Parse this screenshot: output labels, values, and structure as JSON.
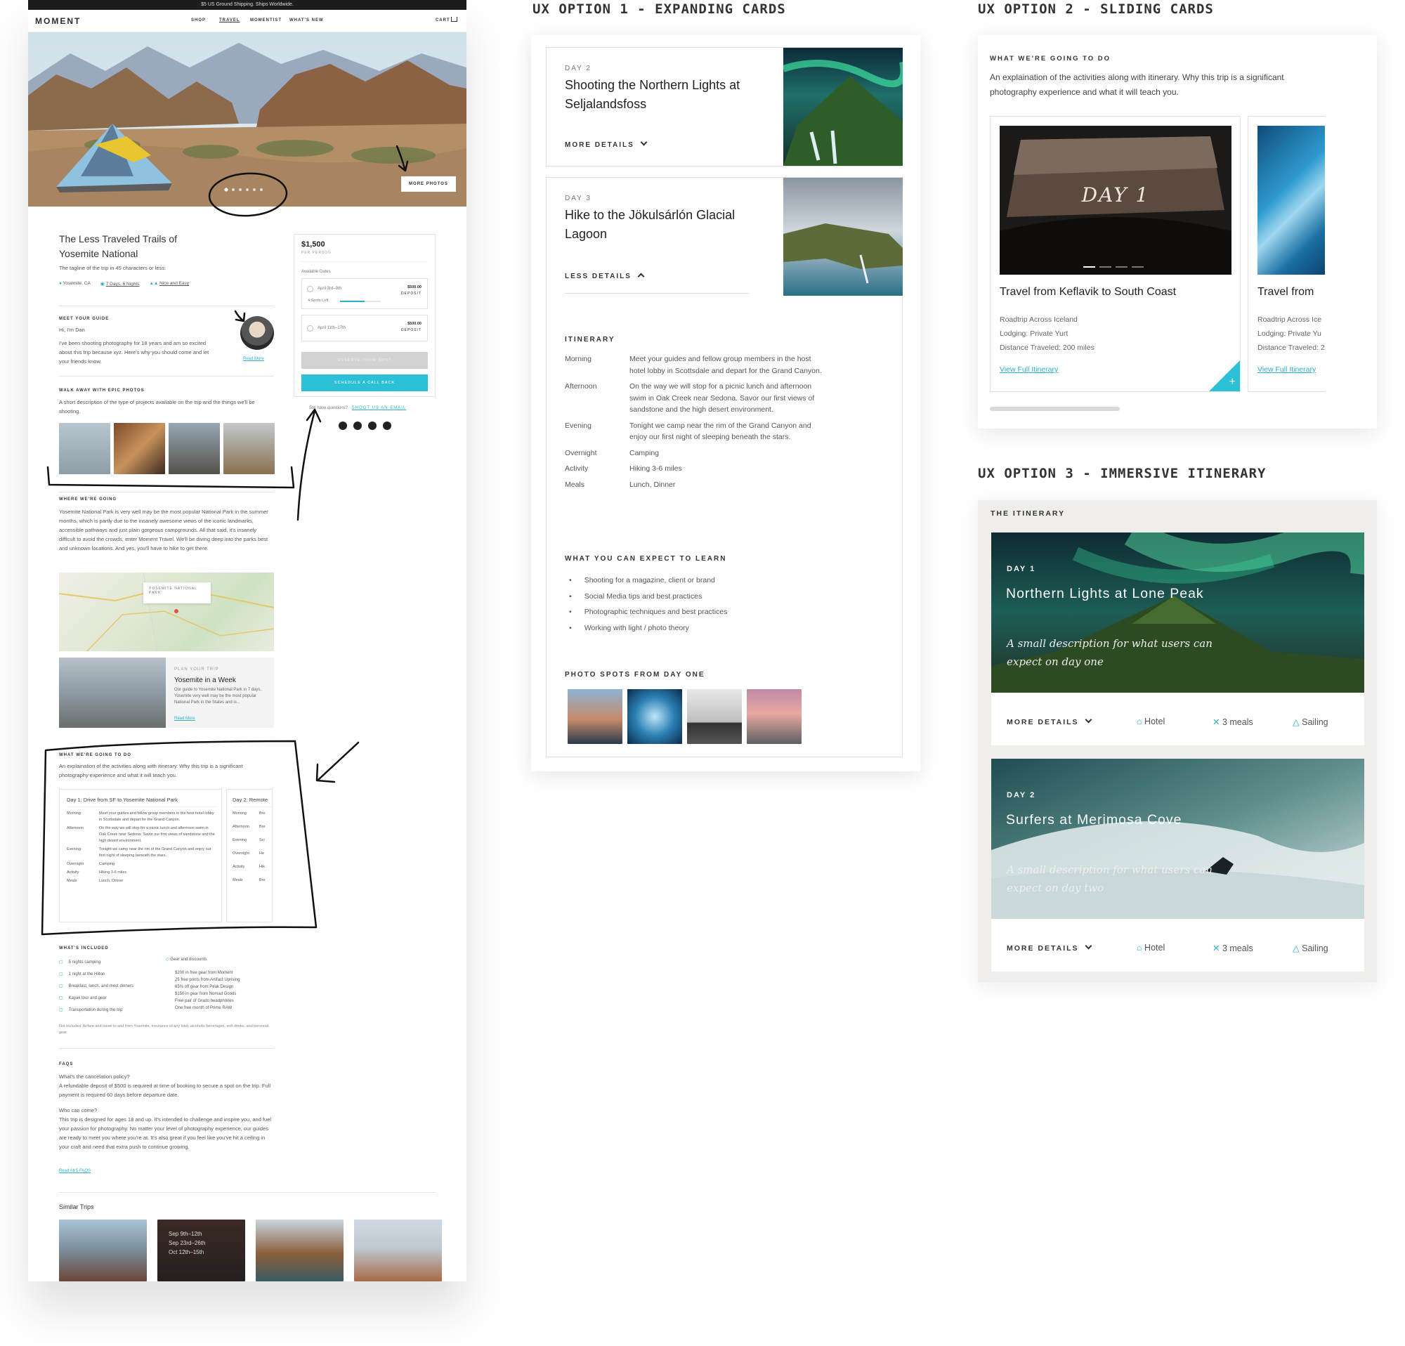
{
  "left_page": {
    "promo": "$5 US Ground Shipping. Ships Worldwide.",
    "logo": "MOMENT",
    "nav": [
      "SHOP",
      "TRAVEL",
      "MOMENTIST",
      "WHAT'S NEW"
    ],
    "cart": "CART",
    "more_photos": "MORE PHOTOS",
    "trip_title": "The Less Traveled Trails of Yosemite National",
    "tagline": "The tagline of the trip in 45 characters or less.",
    "meta": [
      "Yosemite, CA",
      "7 Days, 6 Nights",
      "Nice and Easy"
    ],
    "guide": {
      "label": "MEET YOUR GUIDE",
      "greeting": "Hi, I'm Dan",
      "text": "I've been shooting photography for 18 years and am so excited about this trip because xyz. Here's why you should come and let your friends know.",
      "read_more": "Read More"
    },
    "photos_section": {
      "label": "WALK AWAY WITH EPIC PHOTOS",
      "text": "A short description of the type of projects available on the trip and the things we'll be shooting."
    },
    "where": {
      "label": "WHERE WE'RE GOING",
      "text": "Yosemite National Park is very well may be the most popular National Park in the summer months, which is partly due to the insanely awesome views of the iconic landmarks, accessible pathways and just plain gorgeous campgrounds. All that said, it's insanely difficult to avoid the crowds, enter Moment Travel. We'll be diving deep into the parks best and unknown locations. And yes, you'll have to hike to get there.",
      "map_label": "YOSEMITE NATIONAL PARK"
    },
    "plan": {
      "label": "PLAN YOUR TRIP",
      "title": "Yosemite in a Week",
      "text": "Our guide to Yosemite National Park in 7 days. Yosemite very well may be the most popular National Park in the States and is...",
      "read_more": "Read More"
    },
    "booking": {
      "price": "$1,500",
      "per": "PER PERSON",
      "available": "Available Dates",
      "dates": [
        {
          "label": "April 3rd–9th",
          "price": "$500.00",
          "deposit": "DEPOSIT",
          "spots": "4 Spots Left"
        },
        {
          "label": "April 11th–17th",
          "price": "$500.00",
          "deposit": "DEPOSIT",
          "spots": ""
        }
      ],
      "reserve": "RESERVE YOUR SPOT",
      "schedule": "SCHEDULE A CALL BACK",
      "questions": "Still have questions?",
      "email": "SHOOT US AN EMAIL"
    },
    "todo": {
      "label": "WHAT WE'RE GOING TO DO",
      "text": "An explaination of the activities along with itinerary. Why this trip is a significant photography experience and what it will teach you.",
      "day1_title": "Day 1: Drive from SF to Yosemite National Park",
      "day2_title": "Day 2: Remote",
      "rows": [
        {
          "k": "Morning",
          "v": "Meet your guides and fellow group members in the host hotel lobby in Scottsdale and depart for the Grand Canyon."
        },
        {
          "k": "Afternoon",
          "v": "On the way we will stop for a picnic lunch and afternoon swim in Oak Creek near Sedona. Savor our first views of sandstone and the high desert environment."
        },
        {
          "k": "Evening",
          "v": "Tonight we camp near the rim of the Grand Canyon and enjoy our first night of sleeping beneath the stars."
        },
        {
          "k": "Overnight",
          "v": "Camping"
        },
        {
          "k": "Activity",
          "v": "Hiking 3-6 miles"
        },
        {
          "k": "Meals",
          "v": "Lunch, Dinner"
        }
      ],
      "day2_rows": [
        {
          "k": "Morning",
          "v": "Bre"
        },
        {
          "k": "Afternoon",
          "v": "Bre"
        },
        {
          "k": "Evening",
          "v": "Scr"
        },
        {
          "k": "Overnight",
          "v": "He"
        },
        {
          "k": "Activity",
          "v": "Hik"
        },
        {
          "k": "Meals",
          "v": "Bre"
        }
      ]
    },
    "included": {
      "label": "WHAT'S INCLUDED",
      "items": [
        "5 nights camping",
        "1 night at the Hilton",
        "Breakfast, lunch, and most dinners",
        "Kayak tour and gear",
        "Transportation during the trip"
      ],
      "gear_title": "Gear and discounts",
      "gear": [
        "$200 in free gear from Moment",
        "25 free prints from Artifact Uprising",
        "65% off gear from Peak Design",
        "$150 in gear from Nomad Goods",
        "Free pair of Grado headphones",
        "One free month of Prime RAW"
      ],
      "not_included": "Not Included: Airfare and travel to and from Yosemite, insurance of any kind, alcoholic beverages, soft drinks, and personal gear."
    },
    "faqs": {
      "label": "FAQS",
      "q1": "What's the cancelation policy?",
      "a1": "A refundable deposit of $500 is required at time of booking to secure a spot on the trip. Full payment is required 60 days before departure date.",
      "q2": "Who can come?",
      "a2": "This trip is designed for ages 18 and up. It's intended to challenge and inspire you, and fuel your passion for photography. No matter your level of photography experience, our guides are ready to meet you where you're at. It's also great if you feel like you've hit a ceiling in your craft and need that extra push to continue growing.",
      "read_all": "Read All 5 FAQS"
    },
    "similar": {
      "label": "Similar Trips",
      "dates": [
        "Sep 9th–12th",
        "Sep 23rd–26th",
        "Oct 12th–15th"
      ]
    }
  },
  "option1": {
    "heading": "UX OPTION 1 - EXPANDING CARDS",
    "card1": {
      "day": "DAY 2",
      "title": "Shooting the Northern Lights at Seljalandsfoss",
      "toggle": "MORE DETAILS"
    },
    "card2": {
      "day": "DAY 3",
      "title": "Hike to the Jökulsárlón Glacial Lagoon",
      "toggle": "LESS DETAILS"
    },
    "itinerary_label": "ITINERARY",
    "itinerary": [
      {
        "k": "Morning",
        "v": "Meet your guides and fellow group members in the host hotel lobby in Scottsdale and depart for the Grand Canyon."
      },
      {
        "k": "Afternoon",
        "v": "On the way we will stop for a picnic lunch and afternoon swim in Oak Creek near Sedona. Savor our first views of sandstone and the high desert environment."
      },
      {
        "k": "Evening",
        "v": "Tonight we camp near the rim of the Grand Canyon and enjoy our first night of sleeping beneath the stars."
      },
      {
        "k": "Overnight",
        "v": "Camping"
      },
      {
        "k": "Activity",
        "v": "Hiking 3-6 miles"
      },
      {
        "k": "Meals",
        "v": "Lunch, Dinner"
      }
    ],
    "learn_label": "WHAT YOU CAN EXPECT TO LEARN",
    "learn": [
      "Shooting for a magazine, client or brand",
      "Social Media tips and best practices",
      "Photographic techniques and best practices",
      "Working with light / photo theory"
    ],
    "spots_label": "PHOTO SPOTS FROM DAY ONE"
  },
  "option2": {
    "heading": "UX OPTION 2 - SLIDING CARDS",
    "label": "WHAT WE'RE GOING TO DO",
    "text": "An explaination of the activities along with itinerary. Why this trip is a significant photography experience and what it will teach you.",
    "card": {
      "overlay": "DAY 1",
      "title": "Travel from Keflavik to South Coast",
      "lines": [
        "Roadtrip Across Iceland",
        "Lodging: Private Yurt",
        "Distance Traveled: 200 miles"
      ],
      "link": "View Full Itinerary"
    },
    "card2": {
      "title": "Travel from",
      "lines": [
        "Roadtrip Across Ice",
        "Lodging: Private Yu",
        "Distance Traveled: 2"
      ],
      "link": "View Full Itinerary"
    }
  },
  "option3": {
    "heading": "UX OPTION 3 - IMMERSIVE ITINERARY",
    "label": "THE ITINERARY",
    "days": [
      {
        "day": "DAY 1",
        "title": "Northern Lights at Lone Peak",
        "desc": "A small description for what users can expect on day one",
        "more": "MORE DETAILS",
        "hotel": "Hotel",
        "meals": "3 meals",
        "activity": "Sailing"
      },
      {
        "day": "DAY 2",
        "title": "Surfers at Merimosa Cove",
        "desc": "A small description for what users can expect on day two",
        "more": "MORE DETAILS",
        "hotel": "Hotel",
        "meals": "3 meals",
        "activity": "Sailing"
      }
    ]
  },
  "colors": {
    "accent": "#2bb0c8",
    "dark": "#1c1c1c",
    "panel_gray": "#efeeeb"
  }
}
